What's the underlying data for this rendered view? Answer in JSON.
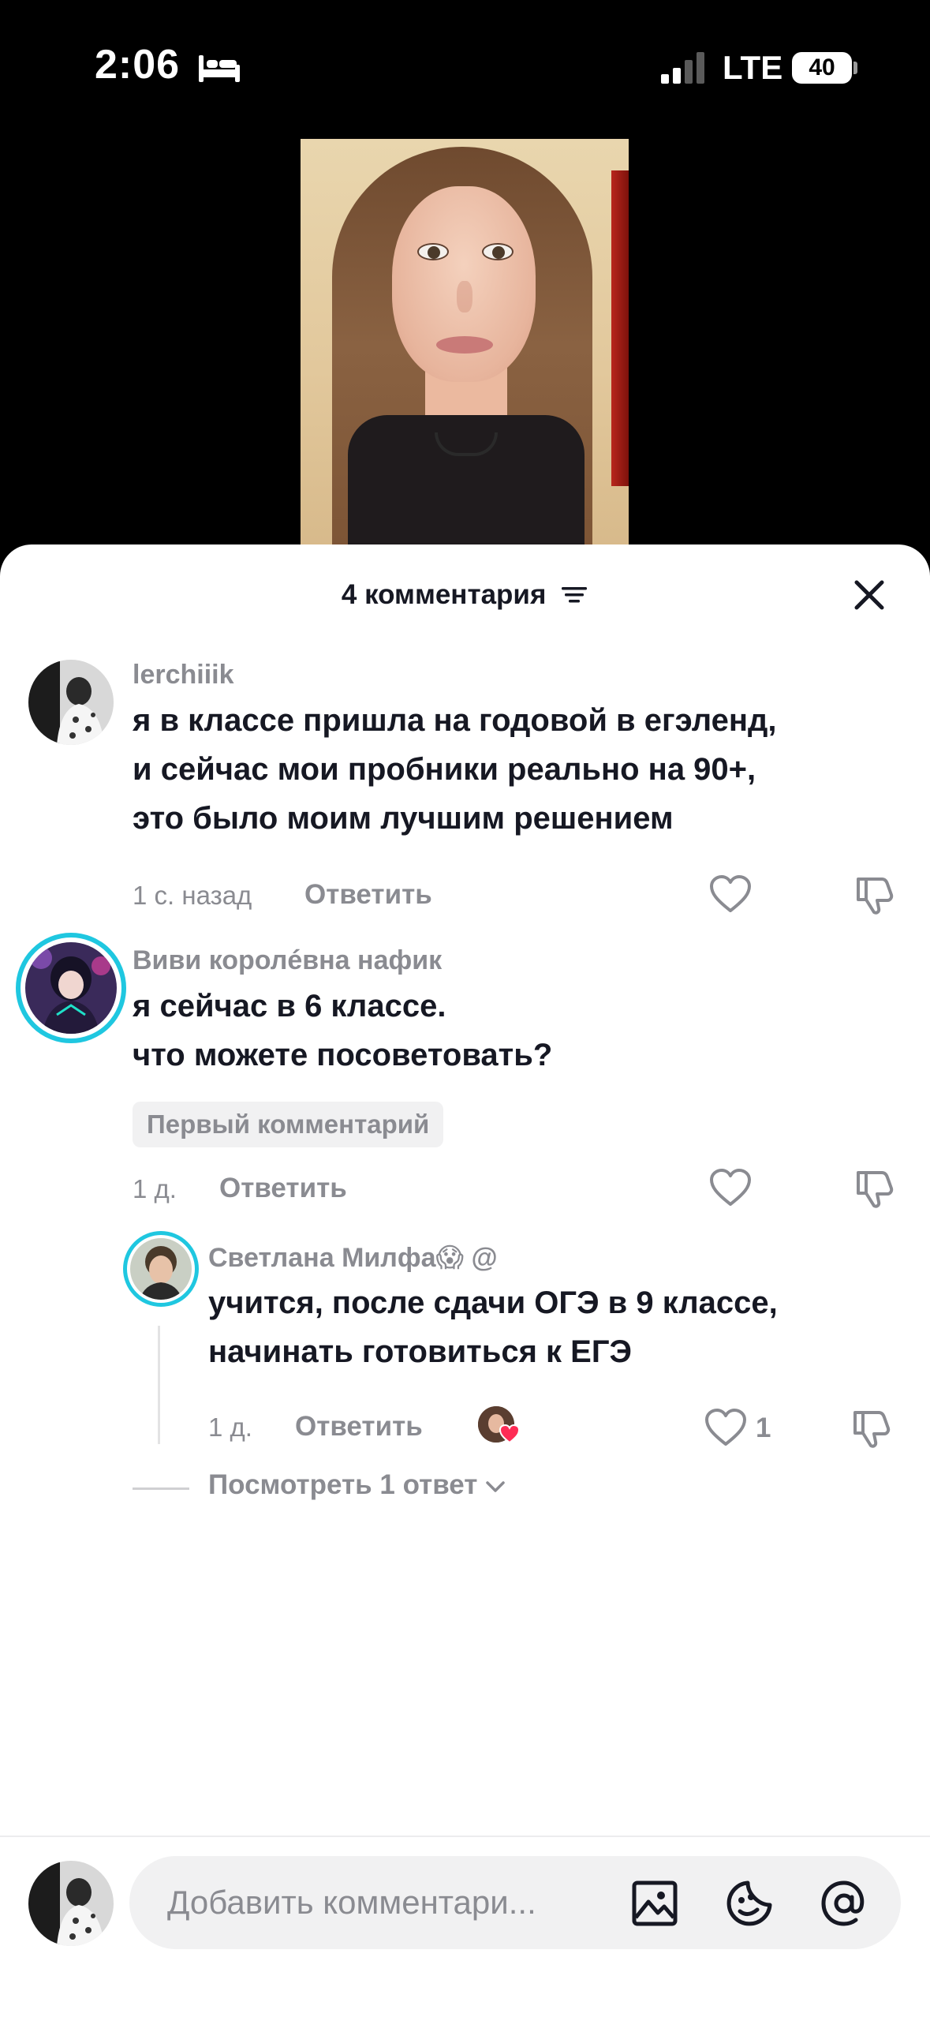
{
  "status_bar": {
    "time": "2:06",
    "network": "LTE",
    "battery": "40"
  },
  "sheet": {
    "title": "4 комментария"
  },
  "comments": [
    {
      "username": "lerchiiik",
      "text": "я в классе пришла на годовой в егэленд,\nи сейчас мои пробники реально на 90+,\nэто было моим лучшим решением",
      "time": "1 с. назад",
      "reply_label": "Ответить"
    },
    {
      "username": "Виви королéвна нафик",
      "text": "я сейчас в 6 классе.\nчто можете посоветовать?",
      "badge": "Первый комментарий",
      "time": "1 д.",
      "reply_label": "Ответить"
    }
  ],
  "reply": {
    "username": "Светлана Милфа😱 @",
    "text": "учится, после сдачи ОГЭ в 9 классе,\nначинать готовиться к ЕГЭ",
    "time": "1 д.",
    "reply_label": "Ответить",
    "likes": "1"
  },
  "view_replies": "Посмотреть 1 ответ",
  "input": {
    "placeholder": "Добавить комментари..."
  },
  "colors": {
    "text": "#161823",
    "muted": "#8a8b91",
    "accent_ring": "#1fc7e0",
    "like_red": "#fe2c55"
  }
}
